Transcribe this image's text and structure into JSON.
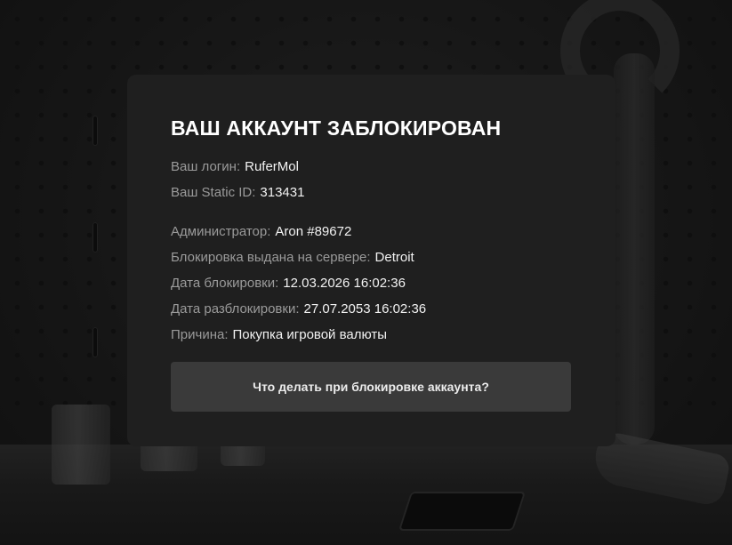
{
  "modal": {
    "title": "ВАШ АККАУНТ ЗАБЛОКИРОВАН",
    "login_label": "Ваш логин:",
    "login_value": "RuferMol",
    "static_id_label": "Ваш Static ID:",
    "static_id_value": "313431",
    "admin_label": "Администратор:",
    "admin_value": "Aron #89672",
    "server_label": "Блокировка выдана на сервере:",
    "server_value": "Detroit",
    "ban_date_label": "Дата блокировки:",
    "ban_date_value": "12.03.2026 16:02:36",
    "unban_date_label": "Дата разблокировки:",
    "unban_date_value": "27.07.2053 16:02:36",
    "reason_label": "Причина:",
    "reason_value": "Покупка игровой валюты",
    "help_button_label": "Что делать при блокировке аккаунта?"
  },
  "colors": {
    "modal_background": "#1f1f1f",
    "button_background": "#3a3a3a",
    "label_text": "#9a9a9a",
    "value_text": "#f2f2f2"
  }
}
